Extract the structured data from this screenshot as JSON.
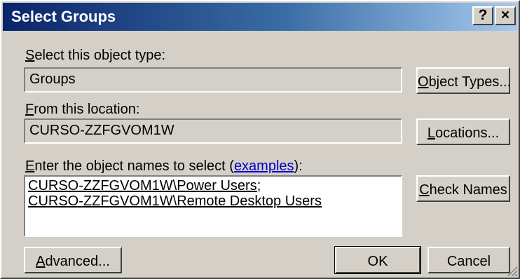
{
  "window": {
    "title": "Select Groups",
    "help_glyph": "?",
    "close_glyph": "×"
  },
  "object_type": {
    "label": {
      "mnemonic": "S",
      "rest": "elect this object type:"
    },
    "value": "Groups",
    "button": {
      "mnemonic": "O",
      "rest": "bject Types..."
    }
  },
  "location": {
    "label": {
      "mnemonic": "F",
      "rest": "rom this location:"
    },
    "value": "CURSO-ZZFGVOM1W",
    "button": {
      "mnemonic": "L",
      "rest": "ocations..."
    }
  },
  "names": {
    "label": {
      "mnemonic": "E",
      "prefix": "nter the object names to select (",
      "link": "examples",
      "suffix": "):"
    },
    "entries": [
      {
        "name": "CURSO-ZZFGVOM1W\\Power Users",
        "sep": ";"
      },
      {
        "name": "CURSO-ZZFGVOM1W\\Remote Desktop Users",
        "sep": ""
      }
    ],
    "check_button": {
      "mnemonic": "C",
      "rest": "heck Names"
    }
  },
  "footer": {
    "advanced": {
      "mnemonic": "A",
      "rest": "dvanced..."
    },
    "ok": "OK",
    "cancel": "Cancel"
  }
}
